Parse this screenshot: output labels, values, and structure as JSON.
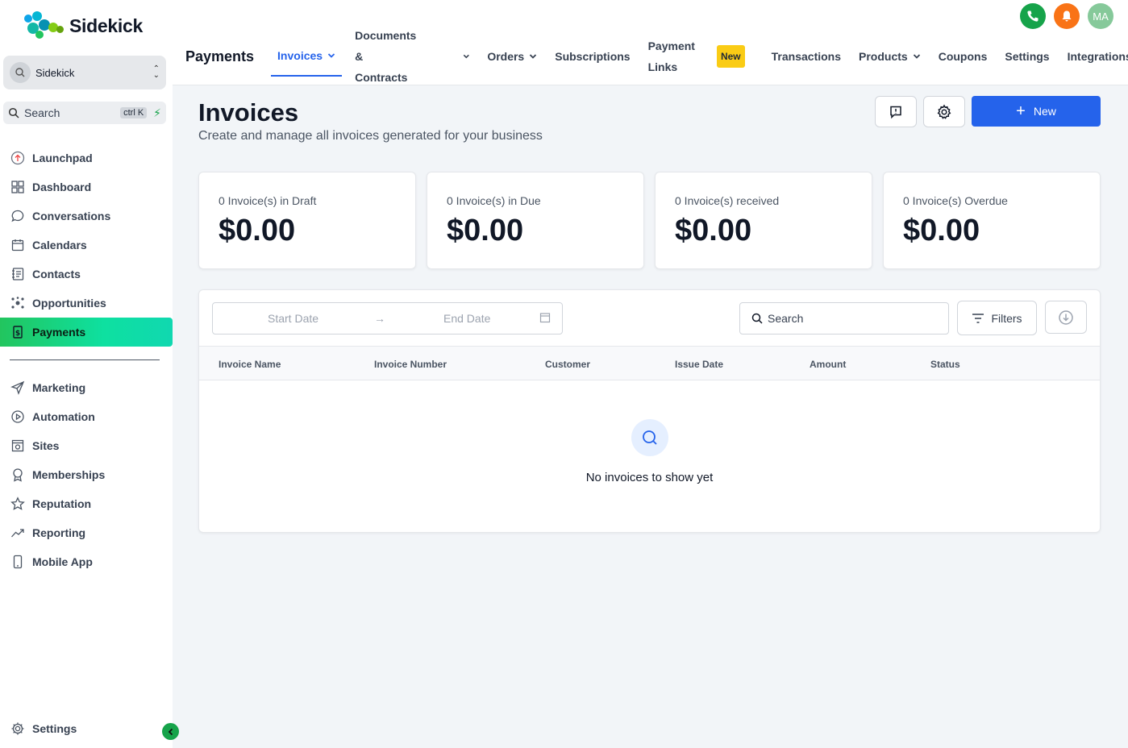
{
  "brand": {
    "name": "Sidekick"
  },
  "account": {
    "name": "Sidekick"
  },
  "sidebar_search": {
    "label": "Search",
    "shortcut": "ctrl K"
  },
  "sidebar": {
    "items_top": [
      {
        "label": "Launchpad",
        "icon": "launchpad-icon"
      },
      {
        "label": "Dashboard",
        "icon": "dashboard-icon"
      },
      {
        "label": "Conversations",
        "icon": "chat-icon"
      },
      {
        "label": "Calendars",
        "icon": "calendar-icon"
      },
      {
        "label": "Contacts",
        "icon": "contacts-icon"
      },
      {
        "label": "Opportunities",
        "icon": "opportunities-icon"
      },
      {
        "label": "Payments",
        "icon": "payments-icon",
        "active": true
      }
    ],
    "items_bottom": [
      {
        "label": "Marketing",
        "icon": "send-icon"
      },
      {
        "label": "Automation",
        "icon": "automation-icon"
      },
      {
        "label": "Sites",
        "icon": "sites-icon"
      },
      {
        "label": "Memberships",
        "icon": "membership-icon"
      },
      {
        "label": "Reputation",
        "icon": "star-icon"
      },
      {
        "label": "Reporting",
        "icon": "reporting-icon"
      },
      {
        "label": "Mobile App",
        "icon": "mobile-icon"
      }
    ],
    "settings_label": "Settings"
  },
  "header": {
    "title": "Payments",
    "user_initials": "MA",
    "tabs": {
      "invoices": "Invoices",
      "documents_l1": "Documents &",
      "documents_l2": "Contracts",
      "orders": "Orders",
      "subscriptions": "Subscriptions",
      "payment_links_l1": "Payment",
      "payment_links_l2": "Links",
      "new_badge": "New",
      "transactions": "Transactions",
      "products": "Products",
      "coupons": "Coupons",
      "settings": "Settings",
      "integrations": "Integrations"
    }
  },
  "page": {
    "title": "Invoices",
    "subtitle": "Create and manage all invoices generated for your business",
    "new_label": "New"
  },
  "stats": [
    {
      "label": "0 Invoice(s) in Draft",
      "value": "$0.00"
    },
    {
      "label": "0 Invoice(s) in Due",
      "value": "$0.00"
    },
    {
      "label": "0 Invoice(s) received",
      "value": "$0.00"
    },
    {
      "label": "0 Invoice(s) Overdue",
      "value": "$0.00"
    }
  ],
  "table": {
    "start_date_placeholder": "Start Date",
    "end_date_placeholder": "End Date",
    "search_placeholder": "Search",
    "filters_label": "Filters",
    "columns": [
      "Invoice Name",
      "Invoice Number",
      "Customer",
      "Issue Date",
      "Amount",
      "Status"
    ],
    "empty_text": "No invoices to show yet"
  },
  "colors": {
    "accent": "#2563eb",
    "phone": "#16a34a",
    "bell": "#f97316",
    "avatar": "#86c99a"
  }
}
